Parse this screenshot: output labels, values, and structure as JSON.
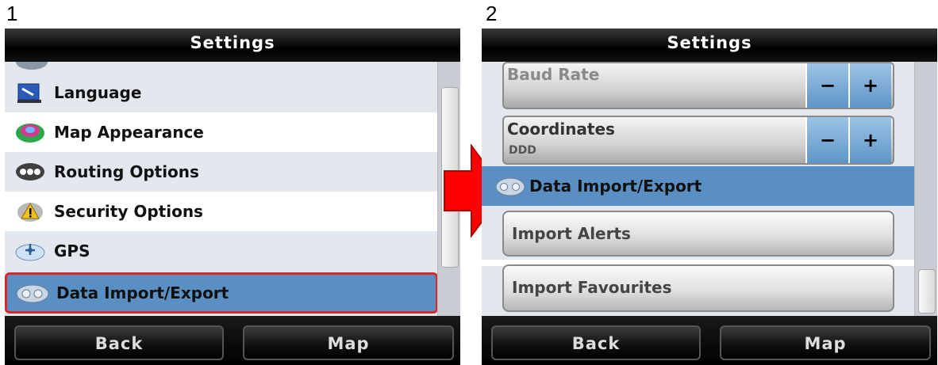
{
  "steps": [
    "1",
    "2"
  ],
  "left": {
    "title": "Settings",
    "items": [
      {
        "label": "Language",
        "icon": "language-icon"
      },
      {
        "label": "Map Appearance",
        "icon": "map-appearance-icon"
      },
      {
        "label": "Routing Options",
        "icon": "routing-icon"
      },
      {
        "label": "Security Options",
        "icon": "security-icon"
      },
      {
        "label": "GPS",
        "icon": "gps-icon"
      },
      {
        "label": "Data Import/Export",
        "icon": "data-import-export-icon",
        "selected": true
      }
    ],
    "footer": {
      "back": "Back",
      "map": "Map"
    }
  },
  "right": {
    "title": "Settings",
    "baud_rate": {
      "label": "Baud Rate",
      "minus": "−",
      "plus": "+"
    },
    "coordinates": {
      "label": "Coordinates",
      "value": "DDD",
      "minus": "−",
      "plus": "+"
    },
    "section_label": "Data Import/Export",
    "buttons": {
      "import_alerts": "Import Alerts",
      "import_favourites": "Import Favourites"
    },
    "footer": {
      "back": "Back",
      "map": "Map"
    }
  },
  "colors": {
    "selected_row": "#5a8fc3",
    "highlight_border": "#d62a2a",
    "arrow": "#ff0000"
  }
}
